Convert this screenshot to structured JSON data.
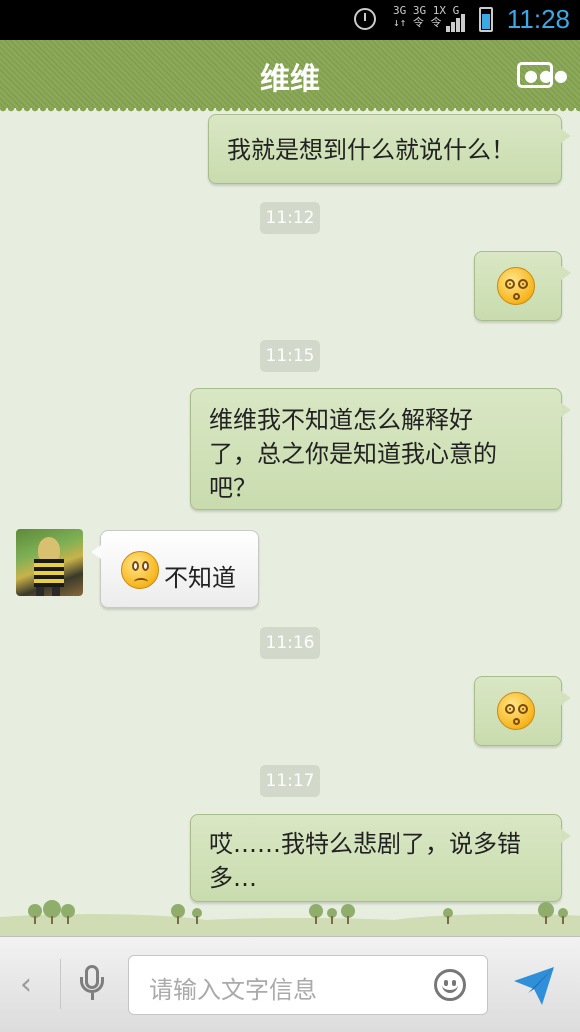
{
  "status_bar": {
    "network_top": "3G 3G 1X G",
    "network_bottom": "↓↑ 令 令",
    "time": "11:28"
  },
  "header": {
    "title": "维维",
    "more_icon": "more-dots-icon"
  },
  "messages": [
    {
      "type": "out",
      "text": "我就是想到什么就说什么！"
    },
    {
      "type": "time",
      "text": "11:12"
    },
    {
      "type": "out-emoji",
      "emoji": "dizzy-face-emoji"
    },
    {
      "type": "time",
      "text": "11:15"
    },
    {
      "type": "out",
      "lines": [
        "维维我不知道怎么解释好",
        "了，总之你是知道我心意的",
        "吧？"
      ]
    },
    {
      "type": "in",
      "emoji": "puzzled-face-emoji",
      "text": "不知道"
    },
    {
      "type": "time",
      "text": "11:16"
    },
    {
      "type": "out-emoji",
      "emoji": "dizzy-face-emoji"
    },
    {
      "type": "time",
      "text": "11:17"
    },
    {
      "type": "out",
      "lines": [
        "哎……我特么悲剧了，说多错",
        "多…"
      ]
    }
  ],
  "input_bar": {
    "back_icon": "back-chevron-icon",
    "mic_icon": "microphone-icon",
    "placeholder": "请输入文字信息",
    "emoji_icon": "smiley-icon",
    "send_icon": "send-arrow-icon"
  },
  "colors": {
    "header": "#86a552",
    "bubble_out": "#d3e2bc",
    "bubble_in": "#ffffff",
    "background": "#e7eee0",
    "accent": "#3aa9e6"
  }
}
